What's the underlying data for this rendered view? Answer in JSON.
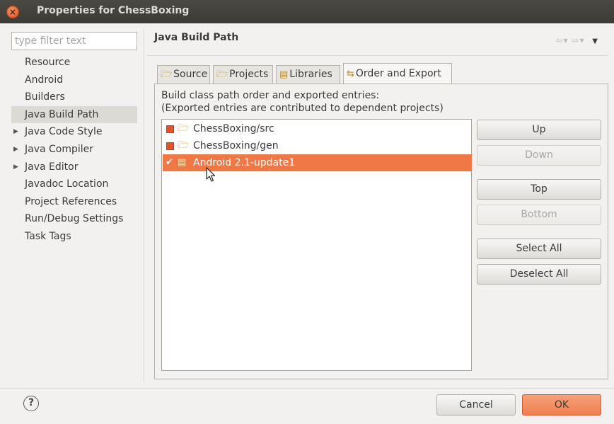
{
  "window": {
    "title": "Properties for ChessBoxing"
  },
  "filter": {
    "placeholder": "type filter text",
    "value": ""
  },
  "tree": {
    "items": [
      {
        "label": "Resource",
        "expandable": false,
        "selected": false
      },
      {
        "label": "Android",
        "expandable": false,
        "selected": false
      },
      {
        "label": "Builders",
        "expandable": false,
        "selected": false
      },
      {
        "label": "Java Build Path",
        "expandable": false,
        "selected": true
      },
      {
        "label": "Java Code Style",
        "expandable": true,
        "selected": false
      },
      {
        "label": "Java Compiler",
        "expandable": true,
        "selected": false
      },
      {
        "label": "Java Editor",
        "expandable": true,
        "selected": false
      },
      {
        "label": "Javadoc Location",
        "expandable": false,
        "selected": false
      },
      {
        "label": "Project References",
        "expandable": false,
        "selected": false
      },
      {
        "label": "Run/Debug Settings",
        "expandable": false,
        "selected": false
      },
      {
        "label": "Task Tags",
        "expandable": false,
        "selected": false
      }
    ]
  },
  "page": {
    "title": "Java Build Path"
  },
  "tabs": [
    {
      "label": "Source",
      "icon": "source-folder-icon",
      "active": false
    },
    {
      "label": "Projects",
      "icon": "projects-icon",
      "active": false
    },
    {
      "label": "Libraries",
      "icon": "libraries-icon",
      "active": false
    },
    {
      "label": "Order and Export",
      "icon": "order-export-icon",
      "active": true
    }
  ],
  "description": {
    "line1": "Build class path order and exported entries:",
    "line2": "(Exported entries are contributed to dependent projects)"
  },
  "entries": [
    {
      "label": "ChessBoxing/src",
      "icon": "source-folder-icon",
      "exported": false,
      "selected": false
    },
    {
      "label": "ChessBoxing/gen",
      "icon": "source-folder-icon",
      "exported": false,
      "selected": false
    },
    {
      "label": "Android 2.1-update1",
      "icon": "library-icon",
      "exported": true,
      "selected": true
    }
  ],
  "side_buttons": {
    "up": {
      "label": "Up",
      "enabled": true
    },
    "down": {
      "label": "Down",
      "enabled": false
    },
    "top": {
      "label": "Top",
      "enabled": true
    },
    "bottom": {
      "label": "Bottom",
      "enabled": false
    },
    "select_all": {
      "label": "Select All",
      "enabled": true
    },
    "deselect_all": {
      "label": "Deselect All",
      "enabled": true
    }
  },
  "footer": {
    "help_glyph": "?",
    "cancel_label": "Cancel",
    "ok_label": "OK"
  },
  "colors": {
    "selection": "#f07746",
    "ok_button": "#ef8658",
    "titlebar": "#3c3b37"
  }
}
